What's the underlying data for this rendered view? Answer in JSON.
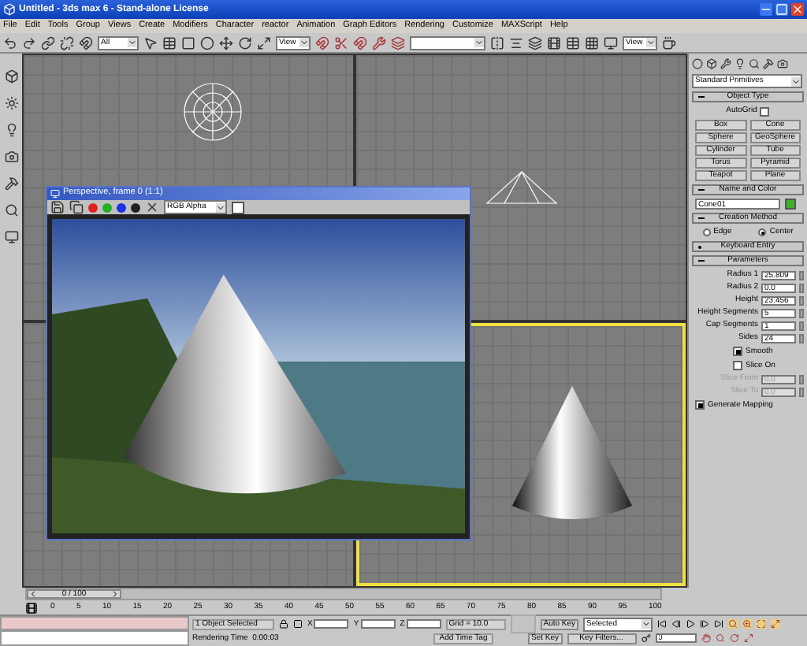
{
  "window": {
    "title": "Untitled - 3ds max 6 - Stand-alone License"
  },
  "menu": [
    "File",
    "Edit",
    "Tools",
    "Group",
    "Views",
    "Create",
    "Modifiers",
    "Character",
    "reactor",
    "Animation",
    "Graph Editors",
    "Rendering",
    "Customize",
    "MAXScript",
    "Help"
  ],
  "toolbar": {
    "selection_filter": "All",
    "reference_coord": "View",
    "render_type": "View"
  },
  "render_window": {
    "title": "Perspective, frame 0 (1:1)",
    "channel": "RGB Alpha"
  },
  "command_panel": {
    "category": "Standard Primitives",
    "object_type": {
      "header": "Object Type",
      "expanded": true,
      "autogrid": {
        "label": "AutoGrid",
        "checked": false
      },
      "buttons": [
        "Box",
        "Cone",
        "Sphere",
        "GeoSphere",
        "Cylinder",
        "Tube",
        "Torus",
        "Pyramid",
        "Teapot",
        "Plane"
      ]
    },
    "name_and_color": {
      "header": "Name and Color",
      "expanded": true,
      "name": "Cone01"
    },
    "creation_method": {
      "header": "Creation Method",
      "expanded": true,
      "options": [
        {
          "label": "Edge",
          "selected": false
        },
        {
          "label": "Center",
          "selected": true
        }
      ]
    },
    "keyboard_entry": {
      "header": "Keyboard Entry",
      "expanded": false
    },
    "parameters": {
      "header": "Parameters",
      "expanded": true,
      "fields": [
        {
          "label": "Radius 1",
          "value": "25.809",
          "disabled": false
        },
        {
          "label": "Radius 2",
          "value": "0.0",
          "disabled": false
        },
        {
          "label": "Height",
          "value": "23.456",
          "disabled": false
        },
        {
          "label": "Height Segments",
          "value": "5",
          "disabled": false
        },
        {
          "label": "Cap Segments",
          "value": "1",
          "disabled": false
        },
        {
          "label": "Sides",
          "value": "24",
          "disabled": false
        }
      ],
      "smooth": {
        "label": "Smooth",
        "checked": true
      },
      "slice_on": {
        "label": "Slice On",
        "checked": false
      },
      "slice_fields": [
        {
          "label": "Slice From",
          "value": "0.0",
          "disabled": true
        },
        {
          "label": "Slice To",
          "value": "0.0",
          "disabled": true
        }
      ],
      "generate_mapping": {
        "label": "Generate Mapping",
        "checked": true
      }
    }
  },
  "time_slider": {
    "label": "0 / 100",
    "level": 0
  },
  "ruler_ticks": [
    "0",
    "5",
    "10",
    "15",
    "20",
    "25",
    "30",
    "35",
    "40",
    "45",
    "50",
    "55",
    "60",
    "65",
    "70",
    "75",
    "80",
    "85",
    "90",
    "95",
    "100"
  ],
  "status_bar": {
    "selection": "1 Object Selected",
    "x_label": "X",
    "y_label": "Y",
    "z_label": "Z",
    "grid": "Grid = 10.0",
    "rendering_time": "Rendering Time  0:00:03",
    "add_time_tag": "Add Time Tag",
    "auto_key": "Auto Key",
    "key_mode": "Selected",
    "set_key": "Set Key",
    "key_filters": "Key Filters...",
    "frame": "0"
  }
}
